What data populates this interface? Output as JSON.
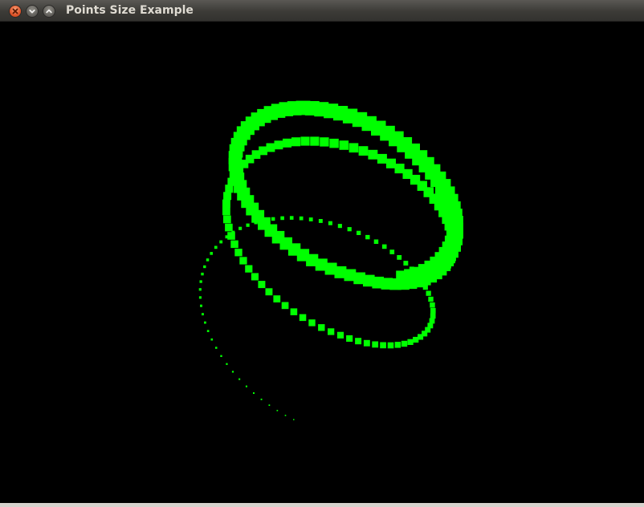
{
  "window": {
    "title": "Points Size Example"
  },
  "buttons": {
    "close_icon": "close-icon",
    "minimize_icon": "minimize-icon",
    "maximize_icon": "maximize-icon"
  },
  "scene": {
    "background_color": "#000000",
    "point_color": "#00ff00",
    "description_shape": "3D helix spiral of square points with increasing point size"
  }
}
